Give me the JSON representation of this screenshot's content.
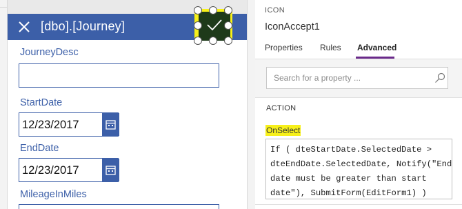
{
  "form": {
    "title": "[dbo].[Journey]",
    "fields": {
      "journey_desc": {
        "label": "JourneyDesc",
        "value": ""
      },
      "start_date": {
        "label": "StartDate",
        "value": "12/23/2017"
      },
      "end_date": {
        "label": "EndDate",
        "value": "12/23/2017"
      },
      "mileage": {
        "label": "MileageInMiles"
      }
    },
    "icons": {
      "close": "close-icon",
      "calendar": "calendar-icon",
      "accept": "checkmark-icon"
    },
    "colors": {
      "header": "#3c5fa8",
      "highlight": "#f7f01a",
      "accept_fill": "#1e3a1a"
    }
  },
  "panel": {
    "kicker": "ICON",
    "control_name": "IconAccept1",
    "tabs": [
      {
        "label": "Properties",
        "active": false
      },
      {
        "label": "Rules",
        "active": false
      },
      {
        "label": "Advanced",
        "active": true
      }
    ],
    "search": {
      "placeholder": "Search for a property ..."
    },
    "section": "ACTION",
    "property": {
      "name": "OnSelect",
      "formula_lines": [
        "If ( dteStartDate.SelectedDate >",
        "dteEndDate.SelectedDate, Notify(\"End",
        "date must be greater than start",
        "date\"), SubmitForm(EditForm1) )"
      ]
    },
    "colors": {
      "active_tab_underline": "#6a2a8a"
    }
  }
}
